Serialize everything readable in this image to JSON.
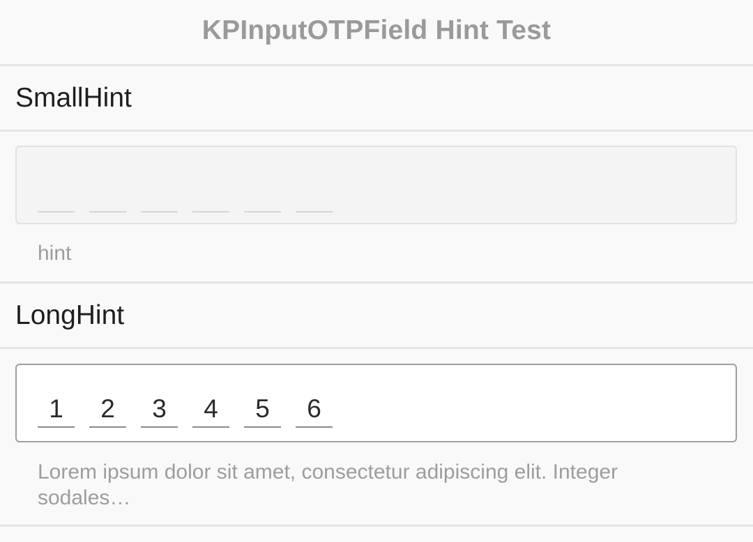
{
  "navbar": {
    "title": "KPInputOTPField Hint Test"
  },
  "sections": [
    {
      "label": "SmallHint",
      "digits": [
        "",
        "",
        "",
        "",
        "",
        ""
      ],
      "hint": "hint"
    },
    {
      "label": "LongHint",
      "digits": [
        "1",
        "2",
        "3",
        "4",
        "5",
        "6"
      ],
      "hint": "Lorem ipsum dolor sit amet, consectetur adipiscing elit. Integer sodales…"
    }
  ]
}
